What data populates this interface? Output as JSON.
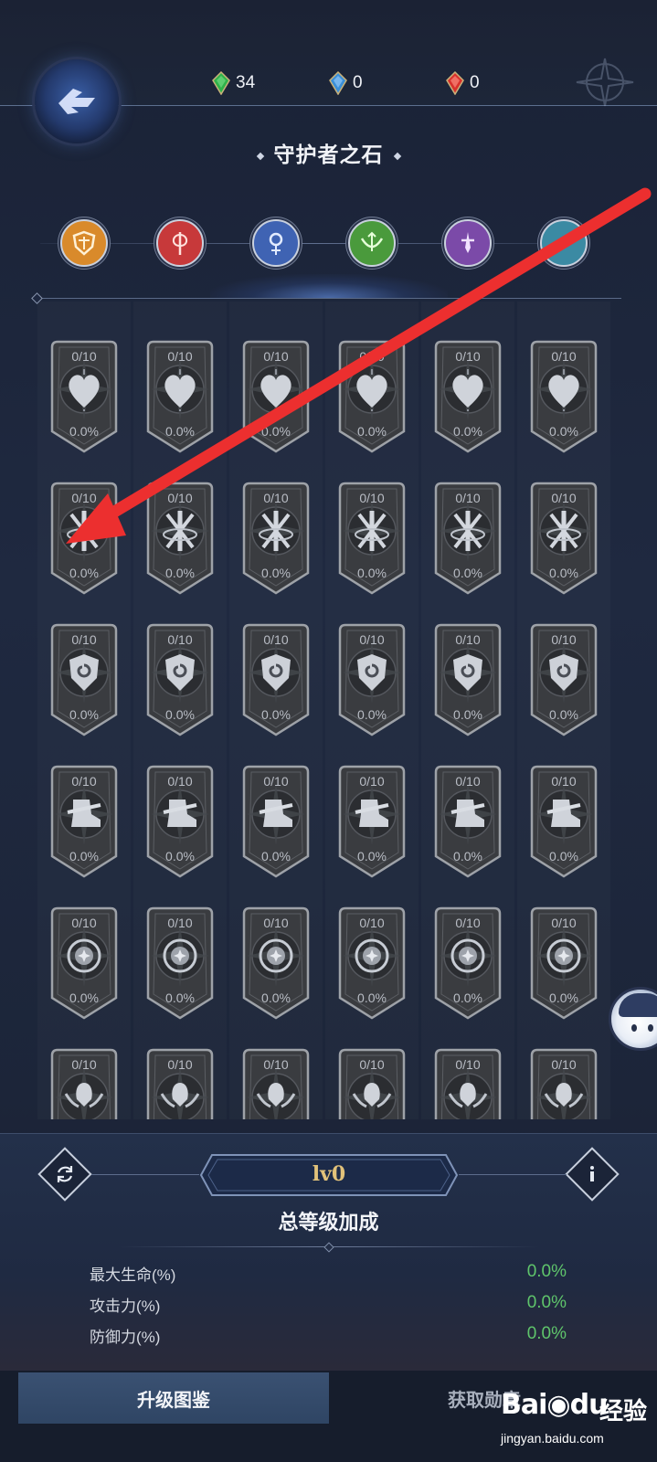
{
  "header": {
    "title": "守护者之石",
    "currencies": [
      {
        "icon": "green-gem-icon",
        "color": "#2fb24a",
        "value": "34"
      },
      {
        "icon": "blue-gem-icon",
        "color": "#3b8fd8",
        "value": "0"
      },
      {
        "icon": "red-gem-icon",
        "color": "#d8322c",
        "value": "0"
      }
    ]
  },
  "classes": [
    {
      "name": "shield-class-icon",
      "color": "#d98a2b"
    },
    {
      "name": "axe-class-icon",
      "color": "#c7393a"
    },
    {
      "name": "staff-class-icon",
      "color": "#3f63b3"
    },
    {
      "name": "bow-class-icon",
      "color": "#4a9a3c"
    },
    {
      "name": "dagger-class-icon",
      "color": "#7b4aa8"
    },
    {
      "name": "wind-class-icon",
      "color": "#3b8aa3"
    }
  ],
  "grid": {
    "rows": [
      {
        "emblem": "heart-emblem-icon",
        "cards": [
          {
            "level": "0/10",
            "percent": "0.0%"
          },
          {
            "level": "0/10",
            "percent": "0.0%"
          },
          {
            "level": "0/10",
            "percent": "0.0%"
          },
          {
            "level": "0/10",
            "percent": "0.0%"
          },
          {
            "level": "0/10",
            "percent": "0.0%"
          },
          {
            "level": "0/10",
            "percent": "0.0%"
          }
        ]
      },
      {
        "emblem": "crossed-swords-emblem-icon",
        "cards": [
          {
            "level": "0/10",
            "percent": "0.0%"
          },
          {
            "level": "0/10",
            "percent": "0.0%"
          },
          {
            "level": "0/10",
            "percent": "0.0%"
          },
          {
            "level": "0/10",
            "percent": "0.0%"
          },
          {
            "level": "0/10",
            "percent": "0.0%"
          },
          {
            "level": "0/10",
            "percent": "0.0%"
          }
        ]
      },
      {
        "emblem": "spiral-shield-emblem-icon",
        "cards": [
          {
            "level": "0/10",
            "percent": "0.0%"
          },
          {
            "level": "0/10",
            "percent": "0.0%"
          },
          {
            "level": "0/10",
            "percent": "0.0%"
          },
          {
            "level": "0/10",
            "percent": "0.0%"
          },
          {
            "level": "0/10",
            "percent": "0.0%"
          },
          {
            "level": "0/10",
            "percent": "0.0%"
          }
        ]
      },
      {
        "emblem": "boot-emblem-icon",
        "cards": [
          {
            "level": "0/10",
            "percent": "0.0%"
          },
          {
            "level": "0/10",
            "percent": "0.0%"
          },
          {
            "level": "0/10",
            "percent": "0.0%"
          },
          {
            "level": "0/10",
            "percent": "0.0%"
          },
          {
            "level": "0/10",
            "percent": "0.0%"
          },
          {
            "level": "0/10",
            "percent": "0.0%"
          }
        ]
      },
      {
        "emblem": "target-emblem-icon",
        "cards": [
          {
            "level": "0/10",
            "percent": "0.0%"
          },
          {
            "level": "0/10",
            "percent": "0.0%"
          },
          {
            "level": "0/10",
            "percent": "0.0%"
          },
          {
            "level": "0/10",
            "percent": "0.0%"
          },
          {
            "level": "0/10",
            "percent": "0.0%"
          },
          {
            "level": "0/10",
            "percent": "0.0%"
          }
        ]
      },
      {
        "emblem": "winged-crest-emblem-icon",
        "cards": [
          {
            "level": "0/10",
            "percent": ""
          },
          {
            "level": "0/10",
            "percent": ""
          },
          {
            "level": "0/10",
            "percent": ""
          },
          {
            "level": "0/10",
            "percent": ""
          },
          {
            "level": "0/10",
            "percent": ""
          },
          {
            "level": "0/10",
            "percent": ""
          }
        ]
      }
    ]
  },
  "summary": {
    "level_label": "lv0",
    "title": "总等级加成",
    "stats": [
      {
        "label": "最大生命(%)",
        "value": "0.0%"
      },
      {
        "label": "攻击力(%)",
        "value": "0.0%"
      },
      {
        "label": "防御力(%)",
        "value": "0.0%"
      }
    ],
    "left_button_icon": "refresh-icon",
    "right_button_icon": "info-icon"
  },
  "tabs": [
    {
      "label": "升级图鉴",
      "active": true
    },
    {
      "label": "获取勋章",
      "active": false
    }
  ],
  "watermark": {
    "logo": "Bai",
    "logo_suffix": "du",
    "brand": "经验",
    "url": "jingyan.baidu.com"
  }
}
